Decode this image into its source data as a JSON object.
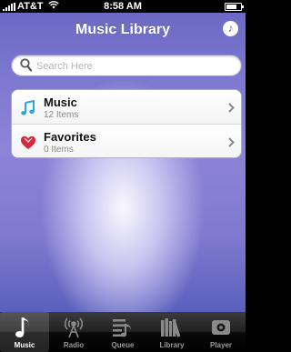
{
  "status_bar": {
    "carrier": "AT&T",
    "time": "8:58 AM",
    "battery_level": 0.75
  },
  "nav": {
    "title": "Music Library"
  },
  "search": {
    "placeholder": "Search Here"
  },
  "library": {
    "items": [
      {
        "title": "Music",
        "subtitle": "12 Items",
        "icon": "music-note-icon"
      },
      {
        "title": "Favorites",
        "subtitle": "0 Items",
        "icon": "heart-icon"
      }
    ]
  },
  "tabs": [
    {
      "label": "Music",
      "icon": "music-note-icon",
      "active": true
    },
    {
      "label": "Radio",
      "icon": "radio-tower-icon",
      "active": false
    },
    {
      "label": "Queue",
      "icon": "queue-icon",
      "active": false
    },
    {
      "label": "Library",
      "icon": "library-books-icon",
      "active": false
    },
    {
      "label": "Player",
      "icon": "player-icon",
      "active": false
    }
  ],
  "colors": {
    "background": "#7a75cf",
    "nav_text": "#ffffff",
    "tab_bar": "#1a1a1a",
    "accent_blue": "#2aa6e6",
    "favorites_red": "#d8263a"
  }
}
